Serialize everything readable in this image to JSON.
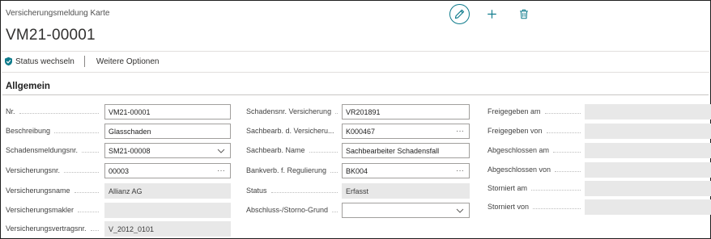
{
  "header": {
    "caption": "Versicherungsmeldung Karte",
    "title": "VM21-00001"
  },
  "toolbar": {
    "status_wechseln": "Status wechseln",
    "weitere_optionen": "Weitere Optionen"
  },
  "section": {
    "title": "Allgemein"
  },
  "column1": [
    {
      "label": "Nr.",
      "value": "VM21-00001",
      "kind": "input"
    },
    {
      "label": "Beschreibung",
      "value": "Glasschaden",
      "kind": "input"
    },
    {
      "label": "Schadensmeldungsnr.",
      "value": "SM21-00008",
      "kind": "select"
    },
    {
      "label": "Versicherungsnr.",
      "value": "00003",
      "kind": "lookup"
    },
    {
      "label": "Versicherungsname",
      "value": "Allianz AG",
      "kind": "readonly"
    },
    {
      "label": "Versicherungsmakler",
      "value": "",
      "kind": "readonly"
    },
    {
      "label": "Versicherungsvertragsnr.",
      "value": "V_2012_0101",
      "kind": "readonly"
    }
  ],
  "column2": [
    {
      "label": "Schadensnr. Versicherung",
      "value": "VR201891",
      "kind": "input"
    },
    {
      "label": "Sachbearb. d. Versicheru...",
      "value": "K000467",
      "kind": "lookup"
    },
    {
      "label": "Sachbearb. Name",
      "value": "Sachbearbeiter Schadensfall",
      "kind": "input"
    },
    {
      "label": "Bankverb. f. Regulierung",
      "value": "BK004",
      "kind": "lookup"
    },
    {
      "label": "Status",
      "value": "Erfasst",
      "kind": "readonly"
    },
    {
      "label": "Abschluss-/Storno-Grund",
      "value": "",
      "kind": "select"
    }
  ],
  "column3": [
    {
      "label": "Freigegeben am",
      "value": "",
      "kind": "readonly"
    },
    {
      "label": "Freigegeben von",
      "value": "",
      "kind": "readonly"
    },
    {
      "label": "Abgeschlossen am",
      "value": "",
      "kind": "readonly"
    },
    {
      "label": "Abgeschlossen von",
      "value": "",
      "kind": "readonly"
    },
    {
      "label": "Storniert am",
      "value": "",
      "kind": "readonly"
    },
    {
      "label": "Storniert von",
      "value": "",
      "kind": "readonly"
    }
  ],
  "icons": {
    "edit": "pencil-icon",
    "add": "plus-icon",
    "delete": "trash-icon",
    "status": "shield-check-icon",
    "lookup": "ellipsis-icon",
    "select": "chevron-down-icon"
  },
  "colors": {
    "accent": "#0f7b8c",
    "readonly_field": "#e8e8e8",
    "field_border": "#a19f9d"
  }
}
